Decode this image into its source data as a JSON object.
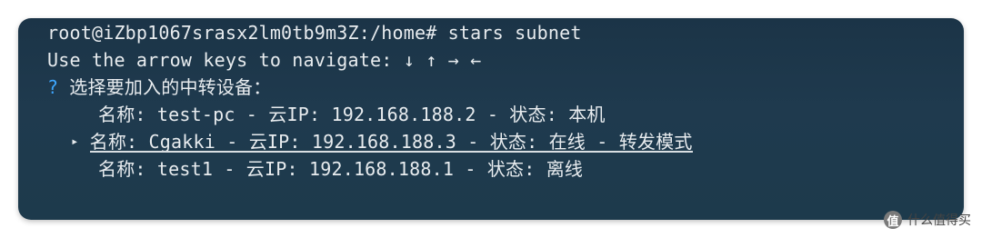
{
  "terminal": {
    "prompt_command": "root@iZbp1067srasx2lm0tb9m3Z:/home# stars subnet",
    "hint": "Use the arrow keys to navigate: ↓ ↑ → ←",
    "question_mark": "?",
    "question": "选择要加入的中转设备：",
    "pointer_glyph": "▸",
    "options": [
      "名称: test-pc - 云IP: 192.168.188.2 - 状态: 本机",
      "名称: Cgakki - 云IP: 192.168.188.3 - 状态: 在线 - 转发模式",
      "名称: test1 - 云IP: 192.168.188.1 - 状态: 离线"
    ],
    "selected_index": 1
  },
  "watermark": {
    "icon_text": "值",
    "text": "什么值得买"
  }
}
